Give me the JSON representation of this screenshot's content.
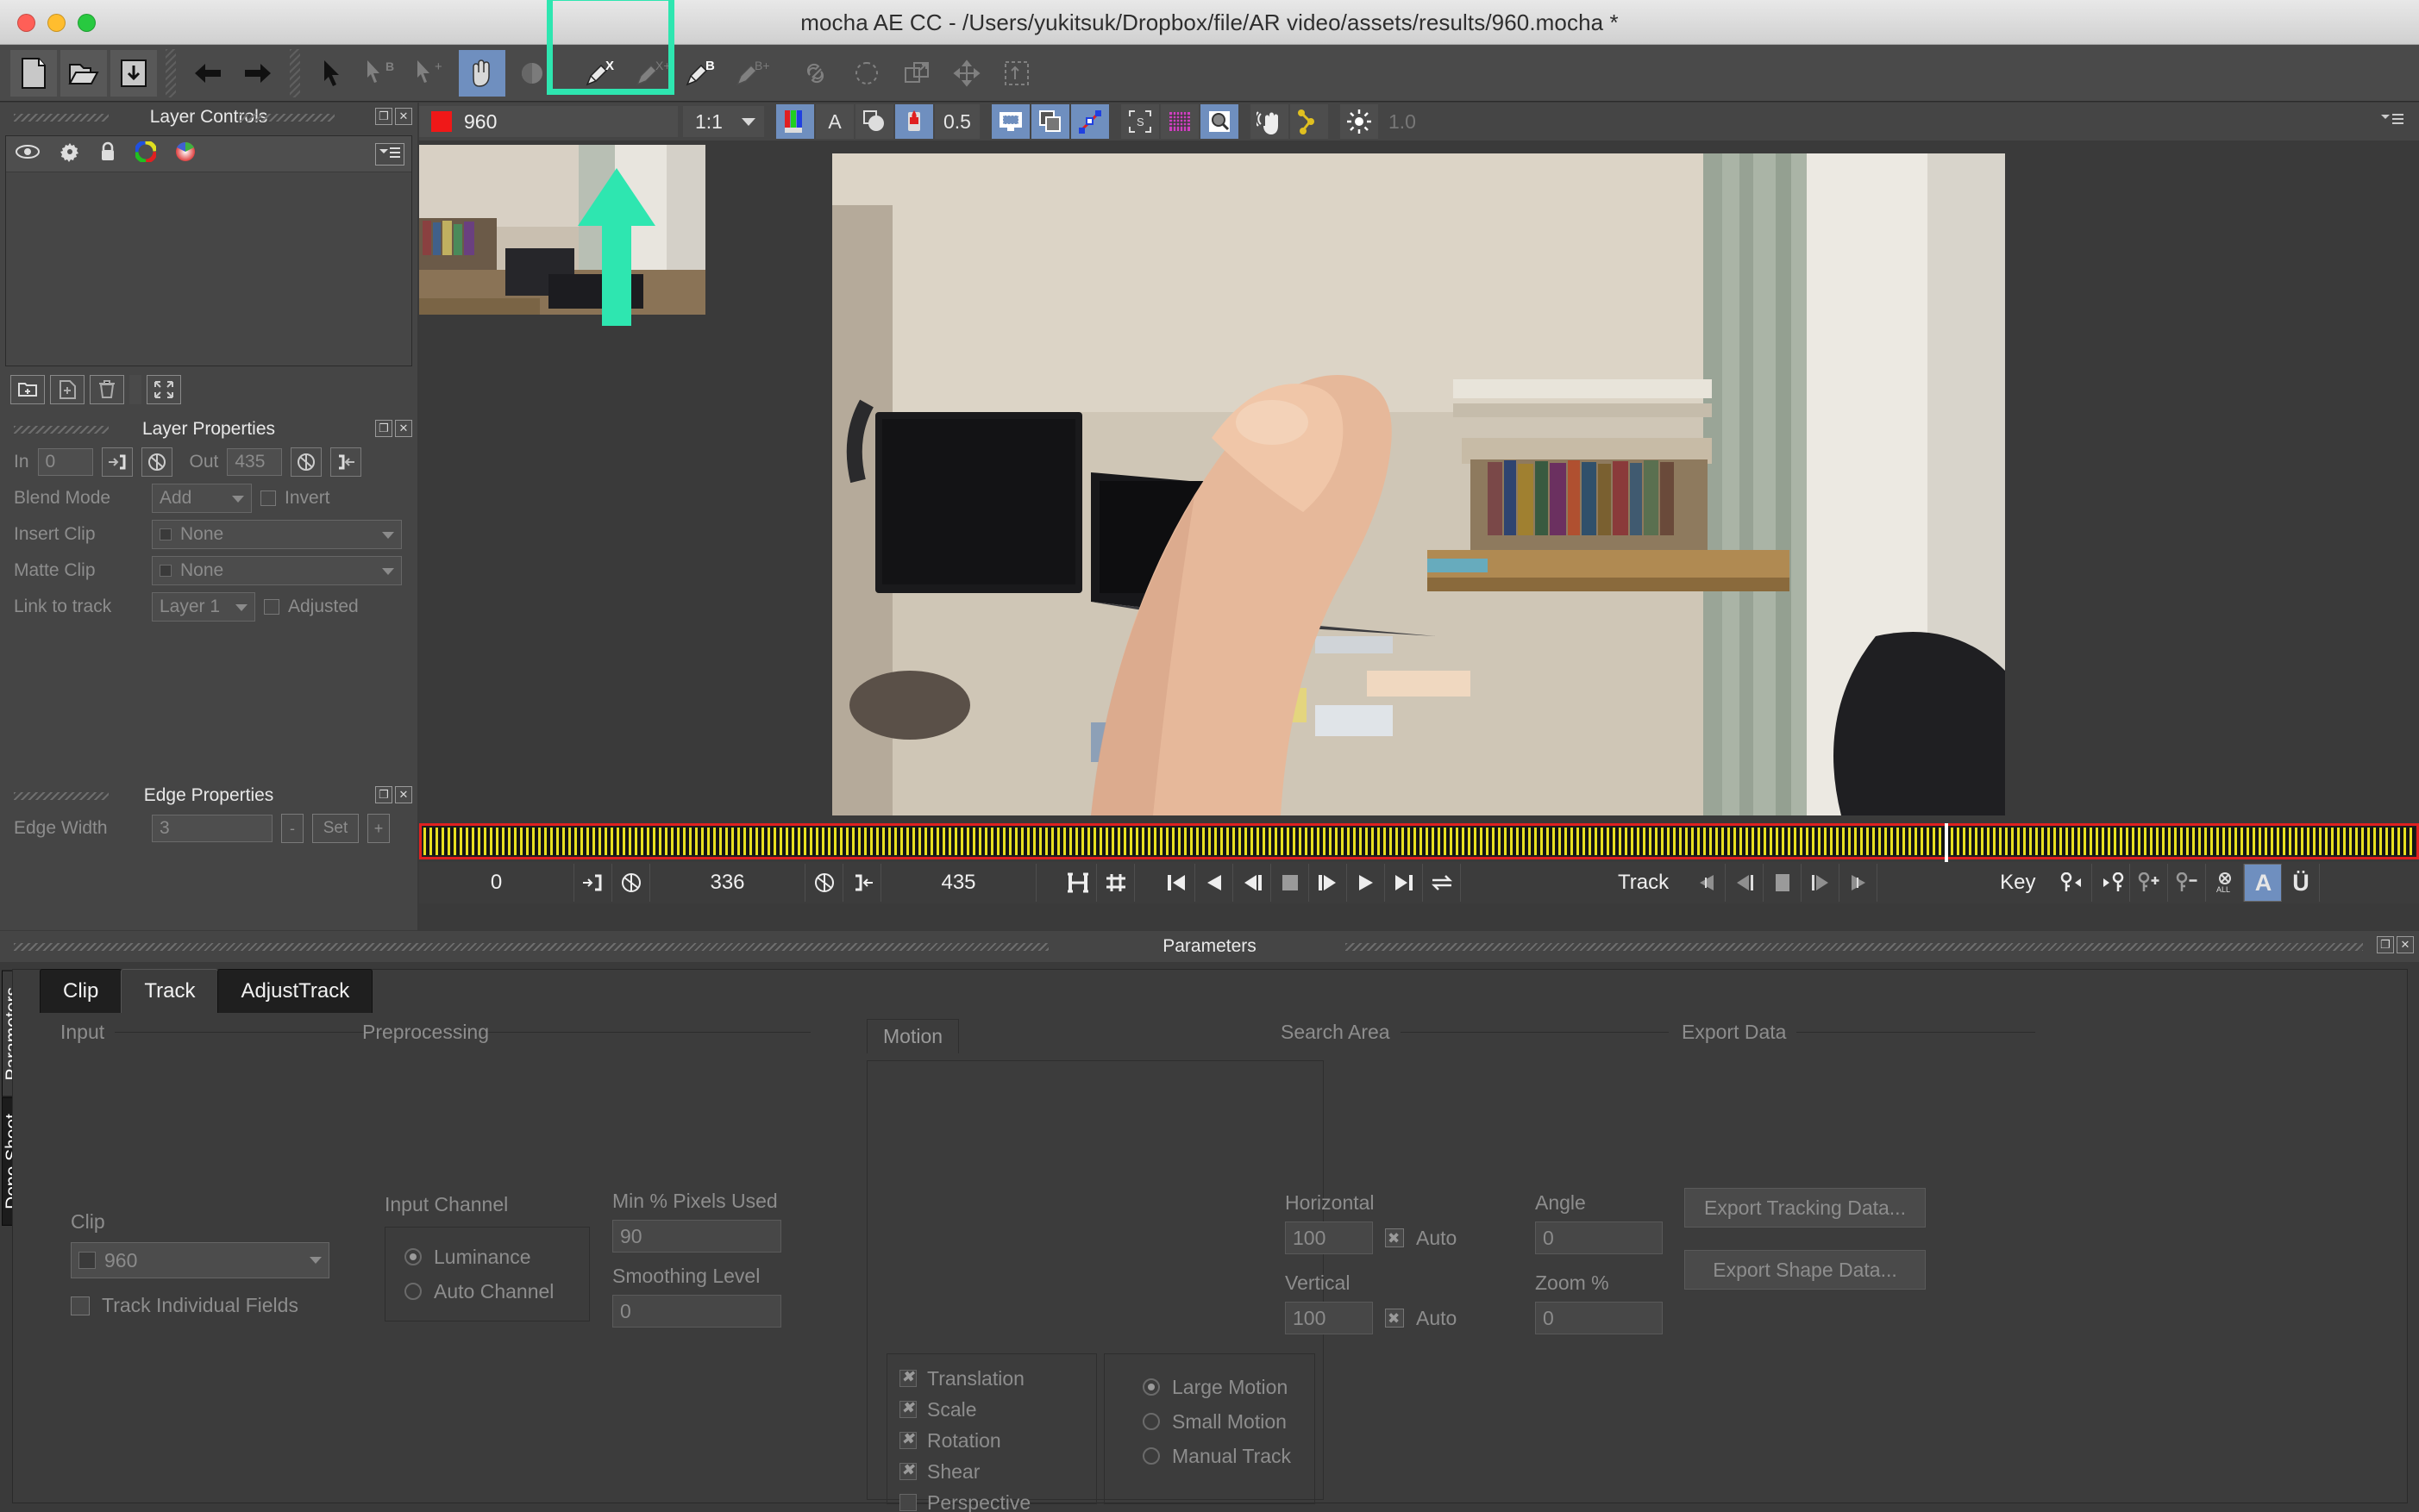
{
  "window": {
    "title": "mocha AE CC - /Users/yukitsuk/Dropbox/file/AR video/assets/results/960.mocha *",
    "traffic_lights": [
      "close",
      "minimize",
      "zoom"
    ]
  },
  "toolbar": {
    "groups": [
      {
        "name": "file",
        "buttons": [
          {
            "icon": "new-project-icon",
            "label": "New Project"
          },
          {
            "icon": "open-project-icon",
            "label": "Open Project"
          },
          {
            "icon": "save-project-icon",
            "label": "Save Project"
          }
        ]
      },
      {
        "name": "navigation",
        "buttons": [
          {
            "icon": "back-arrow-icon",
            "label": "Back"
          },
          {
            "icon": "forward-arrow-icon",
            "label": "Forward"
          }
        ]
      },
      {
        "name": "selection",
        "buttons": [
          {
            "icon": "pointer-icon",
            "label": "Select Tool"
          },
          {
            "icon": "pointer-b-icon",
            "label": "Select Tool B"
          },
          {
            "icon": "pointer-plus-icon",
            "label": "Add Point Tool"
          }
        ]
      },
      {
        "name": "view",
        "buttons": [
          {
            "icon": "pan-hand-icon",
            "label": "Pan",
            "active": true
          },
          {
            "icon": "zoom-circle-icon",
            "label": "Zoom"
          }
        ]
      },
      {
        "name": "xspline",
        "buttons": [
          {
            "icon": "xspline-pen-icon",
            "label": "Create X-Spline Layer"
          },
          {
            "icon": "xspline-add-icon",
            "label": "Add X-Spline Point"
          }
        ]
      },
      {
        "name": "bezier",
        "buttons": [
          {
            "icon": "bezier-pen-icon",
            "label": "Create Bezier Layer"
          },
          {
            "icon": "bezier-add-icon",
            "label": "Add Bezier Point"
          }
        ]
      },
      {
        "name": "edit",
        "buttons": [
          {
            "icon": "link-icon",
            "label": "Link"
          },
          {
            "icon": "reshape-icon",
            "label": "Reshape"
          },
          {
            "icon": "transform-icon",
            "label": "Transform"
          },
          {
            "icon": "move-icon",
            "label": "Move"
          },
          {
            "icon": "marquee-icon",
            "label": "Marquee Select"
          }
        ]
      }
    ]
  },
  "layer_controls": {
    "title": "Layer Controls",
    "icons": [
      {
        "name": "eye-icon",
        "label": "Visibility"
      },
      {
        "name": "gear-icon",
        "label": "Settings"
      },
      {
        "name": "lock-icon",
        "label": "Lock"
      },
      {
        "name": "color-ring-icon",
        "label": "Outline Color"
      },
      {
        "name": "color-wheel-icon",
        "label": "Fill Color"
      },
      {
        "name": "menu-icon",
        "label": "Panel Menu"
      }
    ],
    "footer_buttons": [
      {
        "name": "new-group-icon",
        "label": "New Group"
      },
      {
        "name": "new-layer-icon",
        "label": "New Layer"
      },
      {
        "name": "delete-layer-icon",
        "label": "Delete Layer"
      },
      {
        "name": "fit-icon",
        "label": "Fit Layer"
      }
    ],
    "panel_buttons": [
      "float-icon",
      "close-icon"
    ]
  },
  "layer_properties": {
    "title": "Layer Properties",
    "in_label": "In",
    "in_value": "0",
    "out_label": "Out",
    "out_value": "435",
    "blend_mode_label": "Blend Mode",
    "blend_mode_value": "Add",
    "invert_label": "Invert",
    "insert_clip_label": "Insert Clip",
    "insert_clip_value": "None",
    "matte_clip_label": "Matte Clip",
    "matte_clip_value": "None",
    "link_to_track_label": "Link to track",
    "link_to_track_value": "Layer 1",
    "adjusted_label": "Adjusted"
  },
  "edge_properties": {
    "title": "Edge Properties",
    "edge_width_label": "Edge Width",
    "edge_width_value": "3",
    "set_label": "Set"
  },
  "viewer_toolbar": {
    "clip_name": "960",
    "clip_swatch_color": "#f01818",
    "zoom_level": "1:1",
    "opacity_value": "0.5",
    "brightness_value": "1.0",
    "buttons": [
      {
        "name": "rgb-channels-icon",
        "label": "RGB Channels",
        "active": true
      },
      {
        "name": "alpha-channel-icon",
        "label": "Alpha",
        "glyph": "A"
      },
      {
        "name": "matte-overlay-icon",
        "label": "Matte Overlay"
      },
      {
        "name": "paint-bucket-icon",
        "label": "Fill Overlay",
        "active": true
      },
      {
        "name": "monitor-out-icon",
        "label": "Monitor Output",
        "active": true
      },
      {
        "name": "layers-icon",
        "label": "Show Layers",
        "active": true
      },
      {
        "name": "spline-curve-icon",
        "label": "Show Splines",
        "active": true
      },
      {
        "name": "stabilize-icon",
        "label": "Stabilize",
        "glyph": "S"
      },
      {
        "name": "grid-icon",
        "label": "Grid"
      },
      {
        "name": "magnifier-icon",
        "label": "Zoom Window",
        "active": true
      },
      {
        "name": "hand-motion-icon",
        "label": "Motion Hand"
      },
      {
        "name": "track-path-icon",
        "label": "Track Path"
      },
      {
        "name": "brightness-icon",
        "label": "Brightness"
      }
    ]
  },
  "transport": {
    "frame_start": "0",
    "frame_current": "336",
    "frame_end": "435",
    "track_label": "Track",
    "key_label": "Key",
    "in_point_icon": "set-in-point-icon",
    "out_point_icon": "set-out-point-icon",
    "playback_buttons": [
      {
        "name": "go-to-start-button",
        "label": "Go to Start"
      },
      {
        "name": "play-backward-button",
        "label": "Play Backward"
      },
      {
        "name": "step-back-button",
        "label": "Step Back"
      },
      {
        "name": "stop-button",
        "label": "Stop"
      },
      {
        "name": "step-forward-button",
        "label": "Step Forward"
      },
      {
        "name": "play-forward-button",
        "label": "Play Forward"
      },
      {
        "name": "go-to-end-button",
        "label": "Go to End"
      },
      {
        "name": "loop-button",
        "label": "Loop Playback"
      }
    ],
    "track_buttons": [
      {
        "name": "track-backward-button",
        "label": "Track Backward"
      },
      {
        "name": "track-back-frame-button",
        "label": "Track Back One Frame"
      },
      {
        "name": "track-stop-button",
        "label": "Stop Tracking"
      },
      {
        "name": "track-forward-frame-button",
        "label": "Track Forward One Frame"
      },
      {
        "name": "track-forward-button",
        "label": "Track Forward"
      }
    ],
    "key_buttons": [
      {
        "name": "prev-key-button",
        "label": "Previous Keyframe"
      },
      {
        "name": "next-key-button",
        "label": "Next Keyframe"
      },
      {
        "name": "add-key-button",
        "label": "Add Keyframe"
      },
      {
        "name": "remove-key-button",
        "label": "Remove Keyframe"
      },
      {
        "name": "delete-all-keys-button",
        "label": "Delete All Keyframes",
        "glyph": "ALL"
      },
      {
        "name": "auto-key-button",
        "label": "Auto Key",
        "glyph": "A",
        "active": true
      },
      {
        "name": "undo-key-button",
        "label": "Undo Key",
        "glyph": "Ü"
      }
    ]
  },
  "parameters": {
    "panel_title": "Parameters",
    "side_tabs": [
      {
        "label": "Parameters",
        "active": true
      },
      {
        "label": "Dope Sheet",
        "active": false
      }
    ],
    "tabs": [
      {
        "label": "Clip",
        "active": false
      },
      {
        "label": "Track",
        "active": true
      },
      {
        "label": "AdjustTrack",
        "active": false
      }
    ],
    "groups": {
      "input": {
        "title": "Input",
        "clip_label": "Clip",
        "clip_value": "960",
        "track_individual_fields_label": "Track Individual Fields"
      },
      "preprocessing": {
        "title": "Preprocessing",
        "input_channel_label": "Input Channel",
        "radios": [
          {
            "label": "Luminance",
            "selected": true
          },
          {
            "label": "Auto Channel",
            "selected": false
          }
        ],
        "min_pixels_label": "Min % Pixels Used",
        "min_pixels_value": "90",
        "smoothing_label": "Smoothing Level",
        "smoothing_value": "0"
      },
      "motion": {
        "tab_label": "Motion",
        "checkboxes": [
          {
            "label": "Translation",
            "checked": true
          },
          {
            "label": "Scale",
            "checked": true
          },
          {
            "label": "Rotation",
            "checked": true
          },
          {
            "label": "Shear",
            "checked": true
          },
          {
            "label": "Perspective",
            "checked": false
          }
        ],
        "radios": [
          {
            "label": "Large Motion",
            "selected": true
          },
          {
            "label": "Small Motion",
            "selected": false
          },
          {
            "label": "Manual Track",
            "selected": false
          }
        ]
      },
      "search_area": {
        "title": "Search Area",
        "horizontal_label": "Horizontal",
        "horizontal_value": "100",
        "horizontal_auto_label": "Auto",
        "vertical_label": "Vertical",
        "vertical_value": "100",
        "vertical_auto_label": "Auto",
        "angle_label": "Angle",
        "angle_value": "0",
        "zoom_label": "Zoom %",
        "zoom_value": "0"
      },
      "export_data": {
        "title": "Export Data",
        "export_tracking_label": "Export Tracking Data...",
        "export_shape_label": "Export Shape Data..."
      }
    }
  },
  "annotations": {
    "highlight_color": "#2ee6b0",
    "highlight_toolbar_label": "highlighted toolbar region",
    "arrow_label": "arrow pointing to toolbar"
  }
}
